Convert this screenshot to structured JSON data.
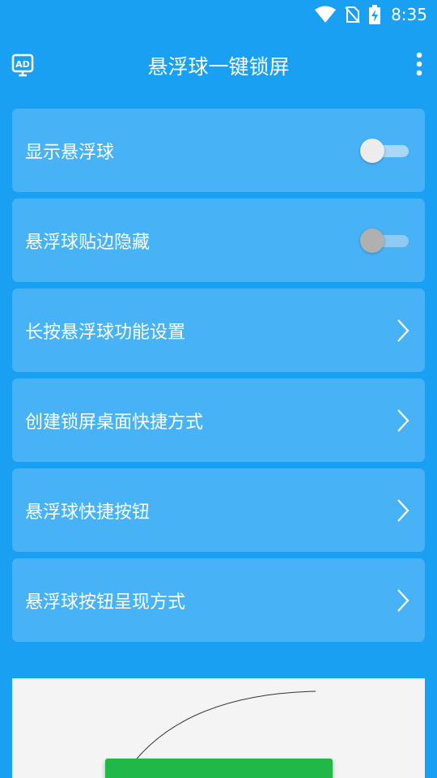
{
  "status_bar": {
    "time": "8:35",
    "icons": [
      "wifi-icon",
      "no-sim-icon",
      "battery-charging-icon"
    ]
  },
  "app_bar": {
    "title": "悬浮球一键锁屏",
    "left_icon": "ad-icon",
    "right_icon": "more-vert-icon"
  },
  "settings": {
    "items": [
      {
        "label": "显示悬浮球",
        "control": "toggle",
        "on": false,
        "enabled": true
      },
      {
        "label": "悬浮球贴边隐藏",
        "control": "toggle",
        "on": false,
        "enabled": false
      },
      {
        "label": "长按悬浮球功能设置",
        "control": "chevron"
      },
      {
        "label": "创建锁屏桌面快捷方式",
        "control": "chevron"
      },
      {
        "label": "悬浮球快捷按钮",
        "control": "chevron"
      },
      {
        "label": "悬浮球按钮呈现方式",
        "control": "chevron"
      }
    ]
  },
  "colors": {
    "background": "#1aa0f2",
    "card": "#47b3f6",
    "ad_button": "#21b84a"
  }
}
